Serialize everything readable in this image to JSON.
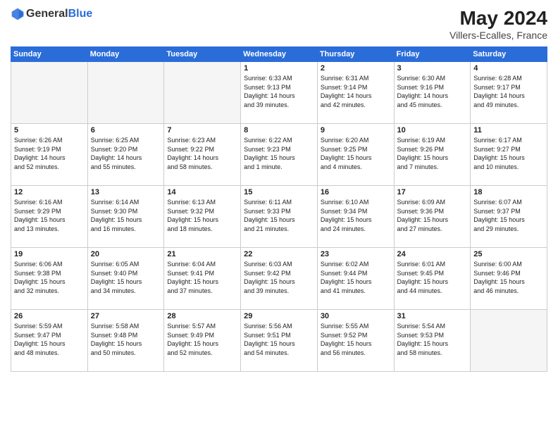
{
  "header": {
    "logo_general": "General",
    "logo_blue": "Blue",
    "month_year": "May 2024",
    "location": "Villers-Ecalles, France"
  },
  "days_of_week": [
    "Sunday",
    "Monday",
    "Tuesday",
    "Wednesday",
    "Thursday",
    "Friday",
    "Saturday"
  ],
  "weeks": [
    [
      {
        "day": "",
        "info": ""
      },
      {
        "day": "",
        "info": ""
      },
      {
        "day": "",
        "info": ""
      },
      {
        "day": "1",
        "info": "Sunrise: 6:33 AM\nSunset: 9:13 PM\nDaylight: 14 hours\nand 39 minutes."
      },
      {
        "day": "2",
        "info": "Sunrise: 6:31 AM\nSunset: 9:14 PM\nDaylight: 14 hours\nand 42 minutes."
      },
      {
        "day": "3",
        "info": "Sunrise: 6:30 AM\nSunset: 9:16 PM\nDaylight: 14 hours\nand 45 minutes."
      },
      {
        "day": "4",
        "info": "Sunrise: 6:28 AM\nSunset: 9:17 PM\nDaylight: 14 hours\nand 49 minutes."
      }
    ],
    [
      {
        "day": "5",
        "info": "Sunrise: 6:26 AM\nSunset: 9:19 PM\nDaylight: 14 hours\nand 52 minutes."
      },
      {
        "day": "6",
        "info": "Sunrise: 6:25 AM\nSunset: 9:20 PM\nDaylight: 14 hours\nand 55 minutes."
      },
      {
        "day": "7",
        "info": "Sunrise: 6:23 AM\nSunset: 9:22 PM\nDaylight: 14 hours\nand 58 minutes."
      },
      {
        "day": "8",
        "info": "Sunrise: 6:22 AM\nSunset: 9:23 PM\nDaylight: 15 hours\nand 1 minute."
      },
      {
        "day": "9",
        "info": "Sunrise: 6:20 AM\nSunset: 9:25 PM\nDaylight: 15 hours\nand 4 minutes."
      },
      {
        "day": "10",
        "info": "Sunrise: 6:19 AM\nSunset: 9:26 PM\nDaylight: 15 hours\nand 7 minutes."
      },
      {
        "day": "11",
        "info": "Sunrise: 6:17 AM\nSunset: 9:27 PM\nDaylight: 15 hours\nand 10 minutes."
      }
    ],
    [
      {
        "day": "12",
        "info": "Sunrise: 6:16 AM\nSunset: 9:29 PM\nDaylight: 15 hours\nand 13 minutes."
      },
      {
        "day": "13",
        "info": "Sunrise: 6:14 AM\nSunset: 9:30 PM\nDaylight: 15 hours\nand 16 minutes."
      },
      {
        "day": "14",
        "info": "Sunrise: 6:13 AM\nSunset: 9:32 PM\nDaylight: 15 hours\nand 18 minutes."
      },
      {
        "day": "15",
        "info": "Sunrise: 6:11 AM\nSunset: 9:33 PM\nDaylight: 15 hours\nand 21 minutes."
      },
      {
        "day": "16",
        "info": "Sunrise: 6:10 AM\nSunset: 9:34 PM\nDaylight: 15 hours\nand 24 minutes."
      },
      {
        "day": "17",
        "info": "Sunrise: 6:09 AM\nSunset: 9:36 PM\nDaylight: 15 hours\nand 27 minutes."
      },
      {
        "day": "18",
        "info": "Sunrise: 6:07 AM\nSunset: 9:37 PM\nDaylight: 15 hours\nand 29 minutes."
      }
    ],
    [
      {
        "day": "19",
        "info": "Sunrise: 6:06 AM\nSunset: 9:38 PM\nDaylight: 15 hours\nand 32 minutes."
      },
      {
        "day": "20",
        "info": "Sunrise: 6:05 AM\nSunset: 9:40 PM\nDaylight: 15 hours\nand 34 minutes."
      },
      {
        "day": "21",
        "info": "Sunrise: 6:04 AM\nSunset: 9:41 PM\nDaylight: 15 hours\nand 37 minutes."
      },
      {
        "day": "22",
        "info": "Sunrise: 6:03 AM\nSunset: 9:42 PM\nDaylight: 15 hours\nand 39 minutes."
      },
      {
        "day": "23",
        "info": "Sunrise: 6:02 AM\nSunset: 9:44 PM\nDaylight: 15 hours\nand 41 minutes."
      },
      {
        "day": "24",
        "info": "Sunrise: 6:01 AM\nSunset: 9:45 PM\nDaylight: 15 hours\nand 44 minutes."
      },
      {
        "day": "25",
        "info": "Sunrise: 6:00 AM\nSunset: 9:46 PM\nDaylight: 15 hours\nand 46 minutes."
      }
    ],
    [
      {
        "day": "26",
        "info": "Sunrise: 5:59 AM\nSunset: 9:47 PM\nDaylight: 15 hours\nand 48 minutes."
      },
      {
        "day": "27",
        "info": "Sunrise: 5:58 AM\nSunset: 9:48 PM\nDaylight: 15 hours\nand 50 minutes."
      },
      {
        "day": "28",
        "info": "Sunrise: 5:57 AM\nSunset: 9:49 PM\nDaylight: 15 hours\nand 52 minutes."
      },
      {
        "day": "29",
        "info": "Sunrise: 5:56 AM\nSunset: 9:51 PM\nDaylight: 15 hours\nand 54 minutes."
      },
      {
        "day": "30",
        "info": "Sunrise: 5:55 AM\nSunset: 9:52 PM\nDaylight: 15 hours\nand 56 minutes."
      },
      {
        "day": "31",
        "info": "Sunrise: 5:54 AM\nSunset: 9:53 PM\nDaylight: 15 hours\nand 58 minutes."
      },
      {
        "day": "",
        "info": ""
      }
    ]
  ]
}
